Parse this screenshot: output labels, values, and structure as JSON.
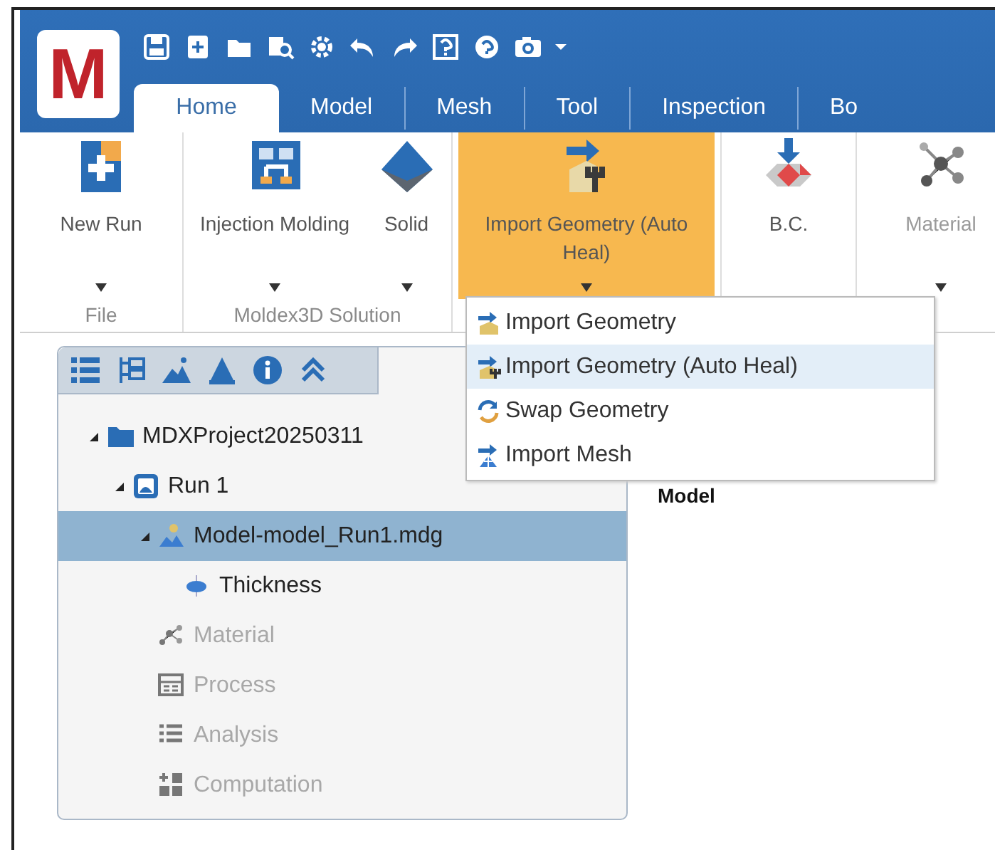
{
  "app": {
    "logo": "M"
  },
  "quick_access": {
    "dropdown": true
  },
  "tabs": [
    {
      "label": "Home",
      "selected": true
    },
    {
      "label": "Model",
      "selected": false
    },
    {
      "label": "Mesh",
      "selected": false
    },
    {
      "label": "Tool",
      "selected": false
    },
    {
      "label": "Inspection",
      "selected": false
    },
    {
      "label": "Bo",
      "selected": false
    }
  ],
  "ribbon_groups": [
    {
      "label": "File",
      "buttons": [
        {
          "label": "New Run",
          "selected": false,
          "disabled": false,
          "dropdown": true
        }
      ]
    },
    {
      "label": "Moldex3D Solution",
      "buttons": [
        {
          "label": "Injection Molding",
          "selected": false,
          "disabled": false,
          "dropdown": true
        },
        {
          "label": "Solid",
          "selected": false,
          "disabled": false,
          "dropdown": true
        }
      ]
    },
    {
      "buttons": [
        {
          "label": "Import Geometry (Auto Heal)",
          "selected": true,
          "disabled": false,
          "dropdown": true
        }
      ]
    },
    {
      "buttons": [
        {
          "label": "B.C.",
          "selected": false,
          "disabled": false,
          "dropdown": false
        }
      ]
    },
    {
      "buttons": [
        {
          "label": "Material",
          "selected": false,
          "disabled": true,
          "dropdown": true
        }
      ]
    }
  ],
  "dropdown_menu": {
    "items": [
      {
        "label": "Import Geometry",
        "selected": false
      },
      {
        "label": "Import Geometry (Auto Heal)",
        "selected": true
      },
      {
        "label": "Swap Geometry",
        "selected": false
      },
      {
        "label": "Import Mesh",
        "selected": false
      }
    ]
  },
  "viewport": {
    "label": "Model"
  },
  "tree": [
    {
      "label": "MDXProject20250311",
      "expanded": true,
      "selected": false,
      "disabled": false,
      "children": [
        {
          "label": "Run 1",
          "expanded": true,
          "selected": false,
          "disabled": false,
          "children": [
            {
              "label": "Model-model_Run1.mdg",
              "expanded": true,
              "selected": true,
              "disabled": false,
              "children": [
                {
                  "label": "Thickness",
                  "selected": false,
                  "disabled": false
                }
              ]
            },
            {
              "label": "Material",
              "selected": false,
              "disabled": true
            },
            {
              "label": "Process",
              "selected": false,
              "disabled": true
            },
            {
              "label": "Analysis",
              "selected": false,
              "disabled": true
            },
            {
              "label": "Computation",
              "selected": false,
              "disabled": true
            }
          ]
        }
      ]
    }
  ]
}
